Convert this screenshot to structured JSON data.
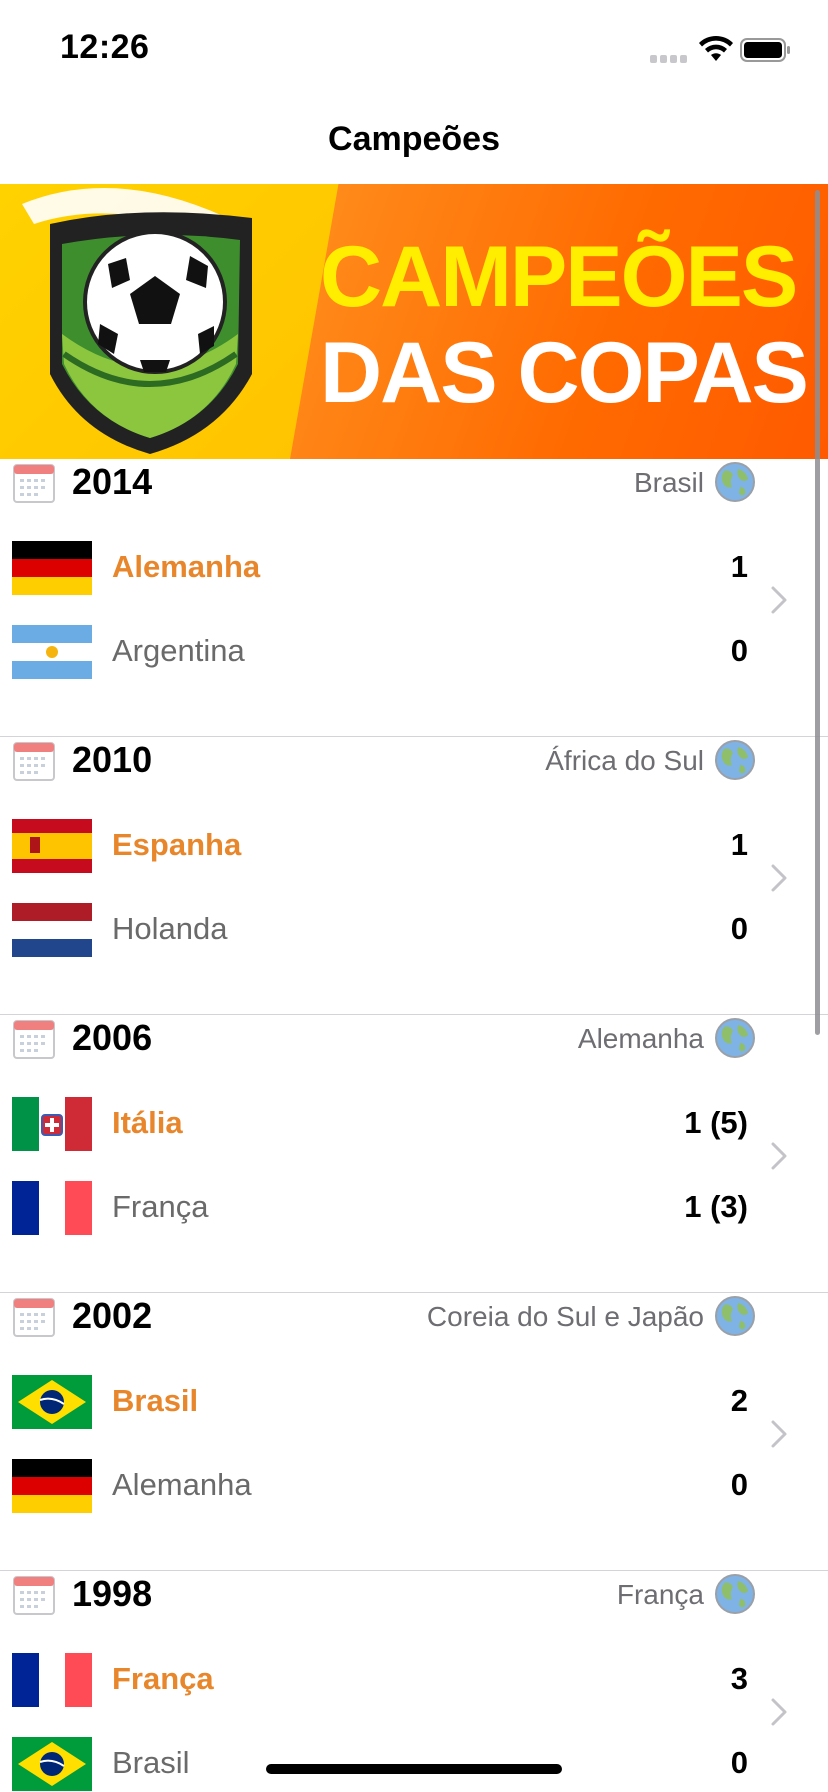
{
  "status": {
    "time": "12:26"
  },
  "nav": {
    "title": "Campeões"
  },
  "banner": {
    "line1": "CAMPEÕES",
    "line2": "DAS COPAS"
  },
  "colors": {
    "winner": "#e8862b",
    "loser": "#6a6a6a",
    "separator": "#d4d4d8"
  },
  "cups": [
    {
      "year": "2014",
      "host": "Brasil",
      "winner": {
        "name": "Alemanha",
        "score": "1",
        "flag": "germany-flag"
      },
      "runner_up": {
        "name": "Argentina",
        "score": "0",
        "flag": "argentina-flag"
      }
    },
    {
      "year": "2010",
      "host": "África do Sul",
      "winner": {
        "name": "Espanha",
        "score": "1",
        "flag": "spain-flag"
      },
      "runner_up": {
        "name": "Holanda",
        "score": "0",
        "flag": "netherlands-flag"
      }
    },
    {
      "year": "2006",
      "host": "Alemanha",
      "winner": {
        "name": "Itália",
        "score": "1 (5)",
        "flag": "italy-flag"
      },
      "runner_up": {
        "name": "França",
        "score": "1 (3)",
        "flag": "france-flag"
      }
    },
    {
      "year": "2002",
      "host": "Coreia do Sul e Japão",
      "winner": {
        "name": "Brasil",
        "score": "2",
        "flag": "brazil-flag"
      },
      "runner_up": {
        "name": "Alemanha",
        "score": "0",
        "flag": "germany-flag"
      }
    },
    {
      "year": "1998",
      "host": "França",
      "winner": {
        "name": "França",
        "score": "3",
        "flag": "france-flag"
      },
      "runner_up": {
        "name": "Brasil",
        "score": "0",
        "flag": "brazil-flag"
      }
    }
  ]
}
